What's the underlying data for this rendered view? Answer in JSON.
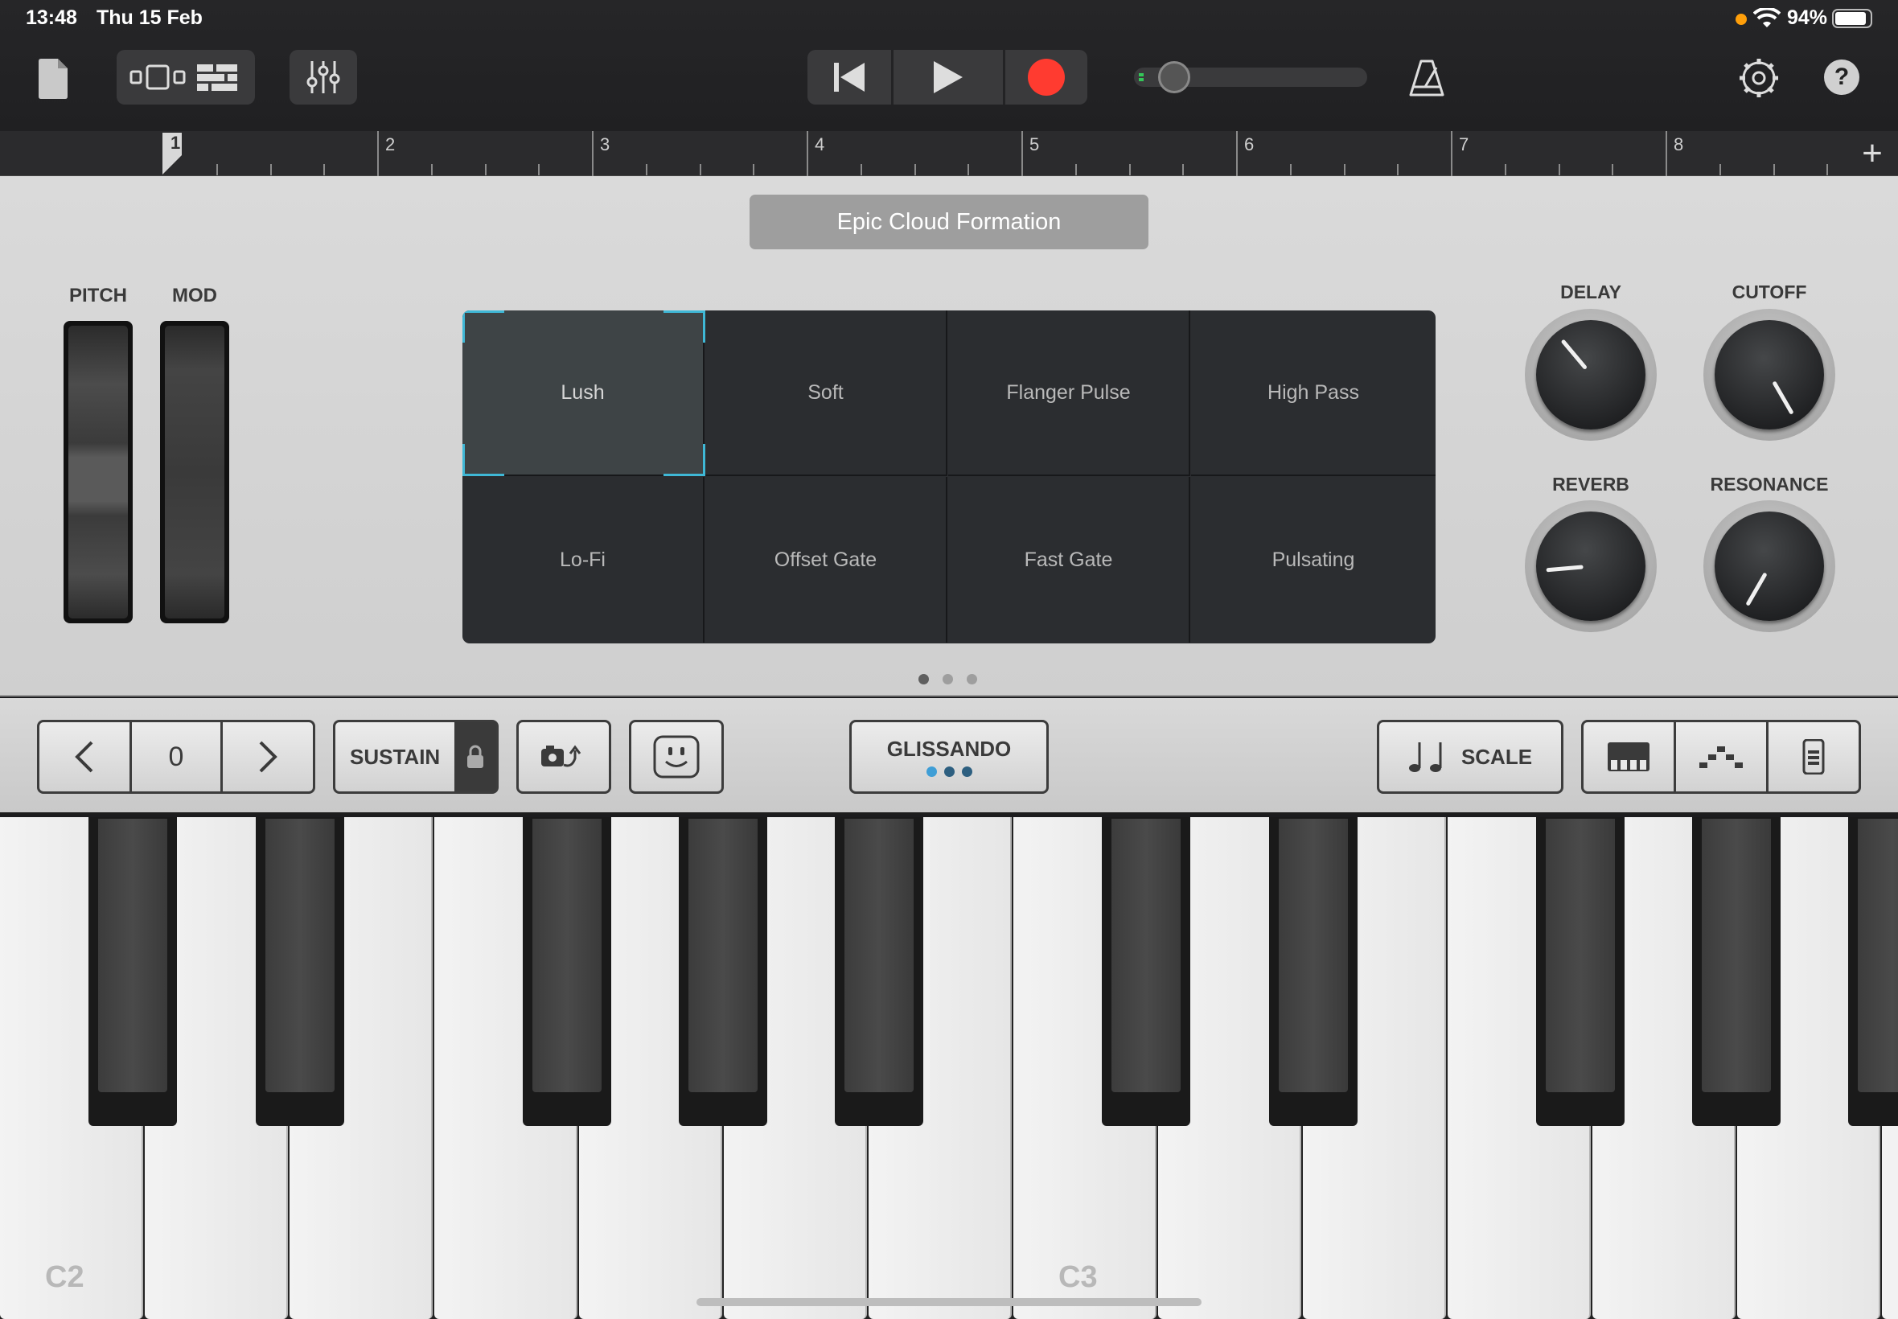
{
  "status_bar": {
    "time": "13:48",
    "date": "Thu 15 Feb",
    "battery": "94%"
  },
  "toolbar": {
    "icons": [
      "document-icon",
      "tracks-view-icon",
      "track-list-icon",
      "mixer-icon",
      "rewind-icon",
      "play-icon",
      "record-icon",
      "metronome-icon",
      "settings-icon",
      "help-icon"
    ],
    "volume_level": 0.05,
    "help_label": "?",
    "record_color": "#ff3b30"
  },
  "ruler": {
    "bars": [
      "1",
      "2",
      "3",
      "4",
      "5",
      "6",
      "7",
      "8"
    ],
    "add_label": "+"
  },
  "patch": {
    "name": "Epic Cloud Formation"
  },
  "wheels": {
    "pitch_label": "PITCH",
    "mod_label": "MOD"
  },
  "grid": {
    "cells": [
      "Lush",
      "Soft",
      "Flanger Pulse",
      "High Pass",
      "Lo-Fi",
      "Offset Gate",
      "Fast Gate",
      "Pulsating"
    ],
    "selected": "Lush",
    "accent": "#3fb8d6"
  },
  "knobs": {
    "delay": {
      "label": "DELAY",
      "angle": -40
    },
    "cutoff": {
      "label": "CUTOFF",
      "angle": 150
    },
    "reverb": {
      "label": "REVERB",
      "angle": -95
    },
    "resonance": {
      "label": "RESONANCE",
      "angle": -150
    }
  },
  "pages": {
    "count": 3,
    "active": 1
  },
  "controls": {
    "octave_value": "0",
    "prev_icon": "chevron-left-icon",
    "next_icon": "chevron-right-icon",
    "sustain_label": "SUSTAIN",
    "arpeggiator_icon": "arpeggiator-icon",
    "velocity_icon": "smiley-icon",
    "glissando_label": "GLISSANDO",
    "scale_label": "SCALE",
    "layout_icons": [
      "piano-keys-icon",
      "arpeggio-dots-icon",
      "chord-strip-icon"
    ]
  },
  "keyboard": {
    "labels": {
      "c2": "C2",
      "c3": "C3"
    }
  }
}
